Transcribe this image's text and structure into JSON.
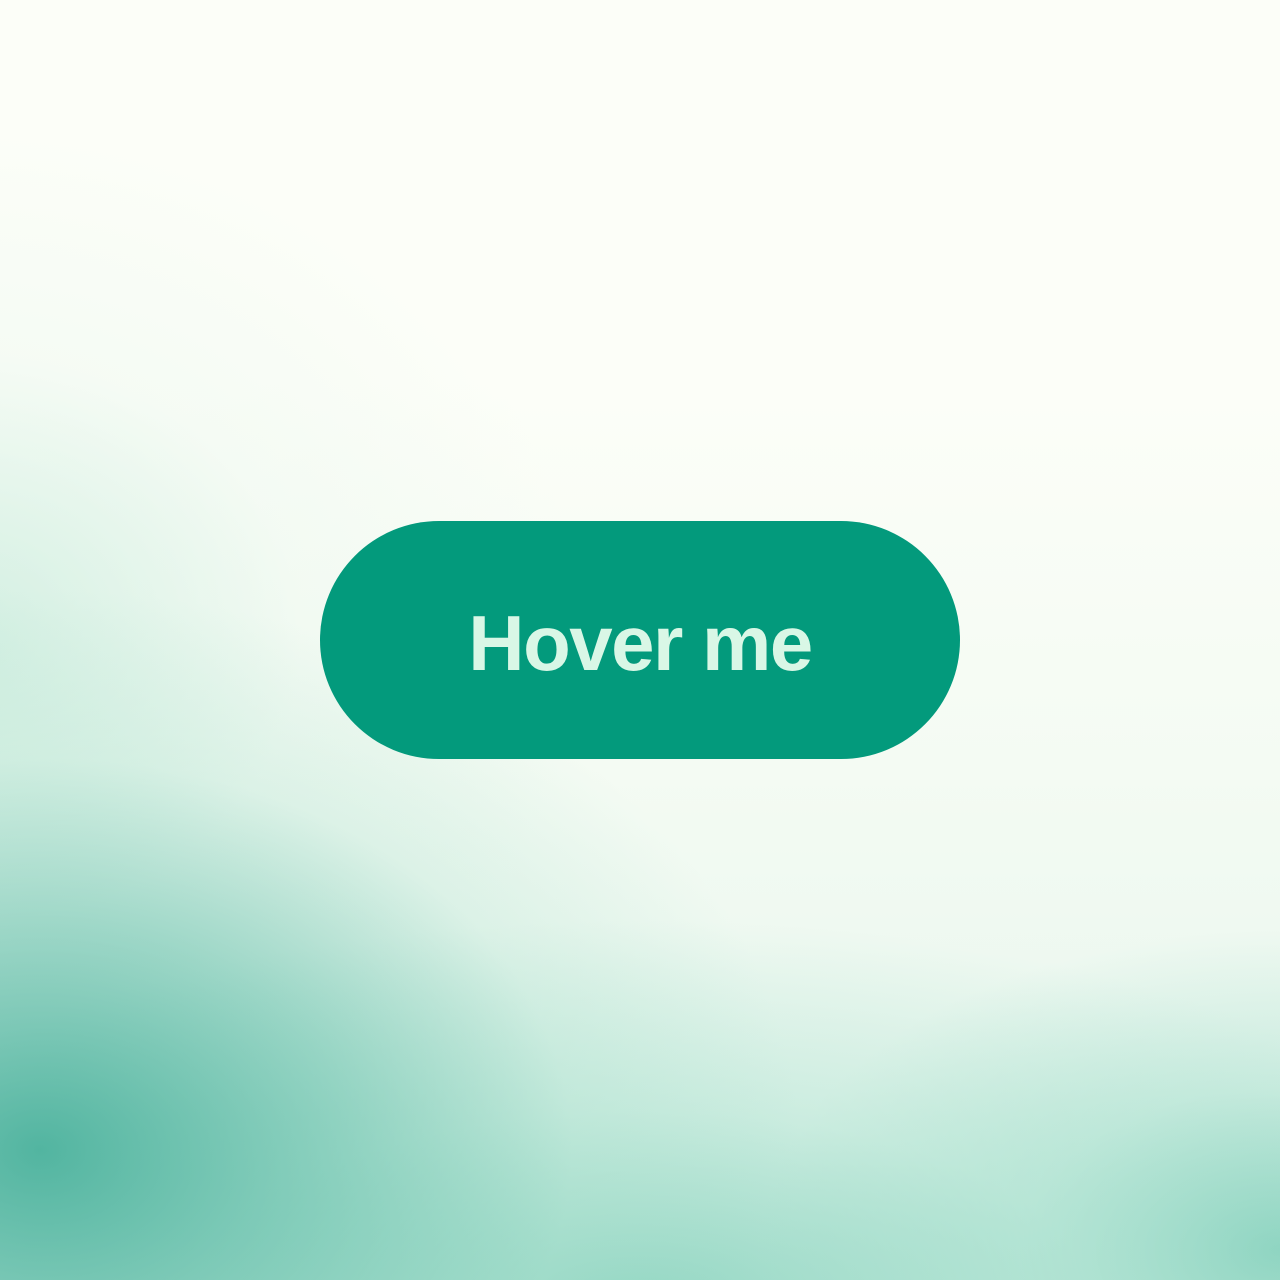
{
  "button": {
    "label": "Hover me"
  },
  "colors": {
    "button_background": "#039a7c",
    "button_text": "#d9f7e6",
    "page_background": "#fcfef8",
    "gradient_accent": "#3aaa94"
  }
}
